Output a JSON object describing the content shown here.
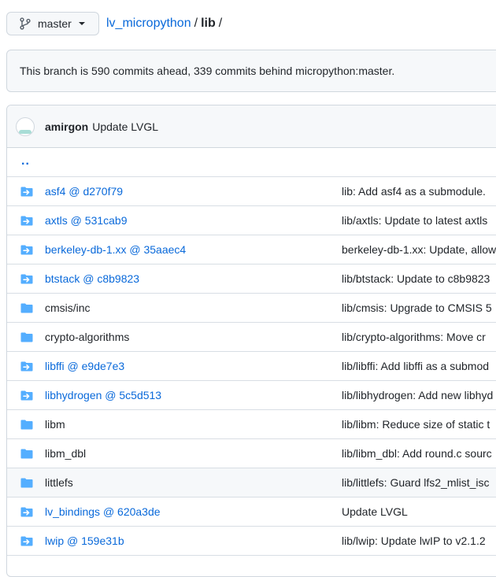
{
  "branch": {
    "name": "master"
  },
  "breadcrumb": {
    "repo": "lv_micropython",
    "sep1": "/",
    "dir": "lib",
    "sep2": "/"
  },
  "ahead_notice": "This branch is 590 commits ahead, 339 commits behind micropython:master.",
  "latest_commit": {
    "author": "amirgon",
    "message": "Update LVGL"
  },
  "parent_dir": "..",
  "files": [
    {
      "name": "asf4 @ d270f79",
      "type": "submodule",
      "message": "lib: Add asf4 as a submodule."
    },
    {
      "name": "axtls @ 531cab9",
      "type": "submodule",
      "message": "lib/axtls: Update to latest axtls"
    },
    {
      "name": "berkeley-db-1.xx @ 35aaec4",
      "type": "submodule",
      "message": "berkeley-db-1.xx: Update, allow"
    },
    {
      "name": "btstack @ c8b9823",
      "type": "submodule",
      "message": "lib/btstack: Update to c8b9823"
    },
    {
      "name": "cmsis/inc",
      "type": "folder",
      "message": "lib/cmsis: Upgrade to CMSIS 5"
    },
    {
      "name": "crypto-algorithms",
      "type": "folder",
      "message": "lib/crypto-algorithms: Move cr"
    },
    {
      "name": "libffi @ e9de7e3",
      "type": "submodule",
      "message": "lib/libffi: Add libffi as a submod"
    },
    {
      "name": "libhydrogen @ 5c5d513",
      "type": "submodule",
      "message": "lib/libhydrogen: Add new libhyd"
    },
    {
      "name": "libm",
      "type": "folder",
      "message": "lib/libm: Reduce size of static t"
    },
    {
      "name": "libm_dbl",
      "type": "folder",
      "message": "lib/libm_dbl: Add round.c sourc"
    },
    {
      "name": "littlefs",
      "type": "folder",
      "message": "lib/littlefs: Guard lfs2_mlist_isc",
      "highlighted": true
    },
    {
      "name": "lv_bindings @ 620a3de",
      "type": "submodule",
      "message": "Update LVGL"
    },
    {
      "name": "lwip @ 159e31b",
      "type": "submodule",
      "message": "lib/lwip: Update lwIP to v2.1.2"
    }
  ],
  "colors": {
    "link": "#0969da",
    "folder_icon": "#54aeff",
    "border": "#d0d7de"
  }
}
